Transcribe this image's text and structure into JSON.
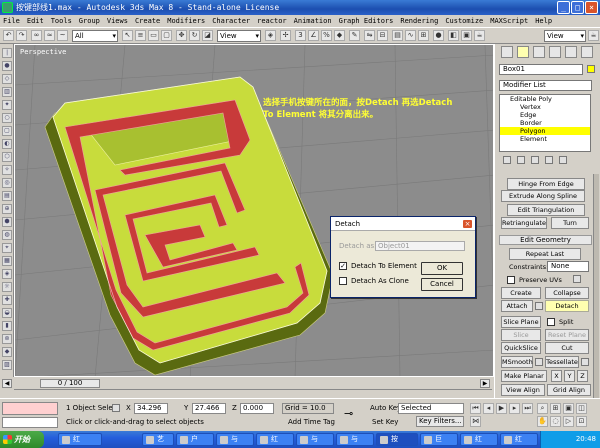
{
  "window": {
    "title": "按键部线1.max - Autodesk 3ds Max 8  -  Stand-alone License"
  },
  "menu": [
    "File",
    "Edit",
    "Tools",
    "Group",
    "Views",
    "Create",
    "Modifiers",
    "Character",
    "reactor",
    "Animation",
    "Graph Editors",
    "Rendering",
    "Customize",
    "MAXScript",
    "Help"
  ],
  "toolbar": {
    "filter": "All",
    "refcoord": "View",
    "named_sel": "View"
  },
  "viewport": {
    "label": "Perspective",
    "note": "选择手机按键所在的面，按Detach 再选Detach To Element 将其分离出来。"
  },
  "dialog": {
    "title": "Detach",
    "detach_as_label": "Detach as:",
    "detach_as_value": "Object01",
    "opt_to_element": "Detach To Element",
    "opt_as_clone": "Detach As Clone",
    "ok": "OK",
    "cancel": "Cancel"
  },
  "command_panel": {
    "object_name": "Box01",
    "modifier_list": "Modifier List",
    "stack": [
      "Editable Poly",
      "Vertex",
      "Edge",
      "Border",
      "Polygon",
      "Element"
    ],
    "buttons": {
      "hinge": "Hinge From Edge",
      "extrude_spline": "Extrude Along Spline",
      "edit_tri": "Edit Triangulation",
      "retriangulate": "Retriangulate",
      "turn": "Turn",
      "edit_geometry": "Edit Geometry",
      "repeat_last": "Repeat Last",
      "constraints": "Constraints:",
      "constraints_value": "None",
      "preserve_uvs": "Preserve UVs",
      "create": "Create",
      "collapse": "Collapse",
      "attach": "Attach",
      "detach": "Detach",
      "slice_plane": "Slice Plane",
      "split": "Split",
      "slice": "Slice",
      "reset_plane": "Reset Plane",
      "quickslice": "QuickSlice",
      "cut": "Cut",
      "msmooth": "MSmooth",
      "tessellate": "Tessellate",
      "make_planar": "Make Planar",
      "x": "X",
      "y": "Y",
      "z": "Z",
      "view_align": "View Align",
      "grid_align": "Grid Align"
    }
  },
  "timeline": {
    "frame": "0 / 100"
  },
  "status": {
    "selection": "1 Object Sele",
    "x": "34.296",
    "y": "27.466",
    "z": "0.000",
    "grid": "Grid = 10.0",
    "autokey": "Auto Key",
    "autokey_value": "Selected",
    "setkey": "Set Key",
    "keyfilters": "Key Filters...",
    "prompt": "Click or click-and-drag to select objects",
    "timetag": "Add Time Tag",
    "label_x": "X",
    "label_y": "Y",
    "label_z": "Z"
  },
  "taskbar": {
    "start": "开始",
    "tasks": [
      "红",
      "艺",
      "户",
      "与",
      "红",
      "与",
      "与",
      "按",
      "巨",
      "红",
      "红"
    ],
    "clock": "20:48"
  }
}
